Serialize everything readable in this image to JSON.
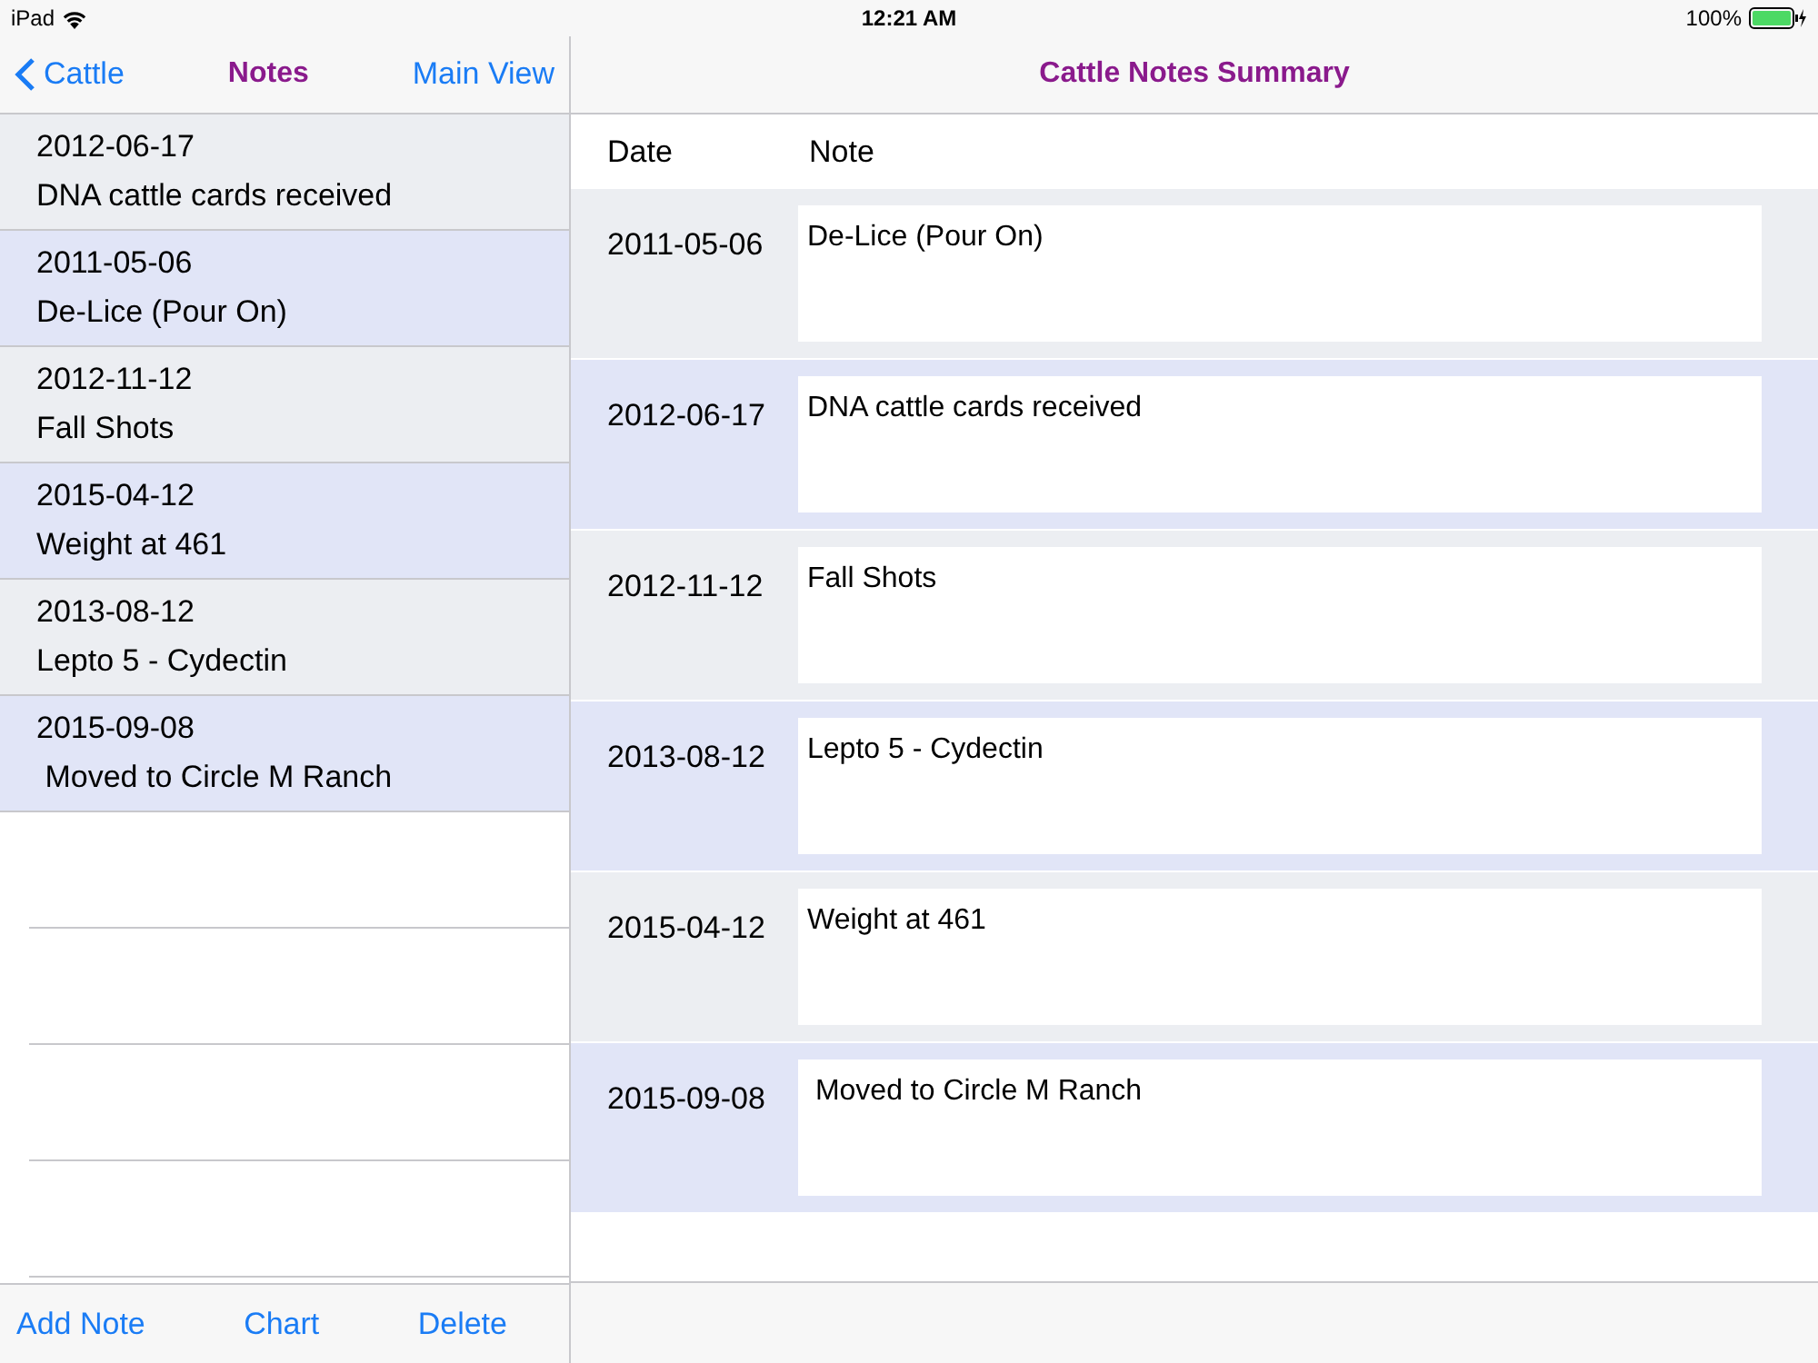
{
  "status_bar": {
    "device": "iPad",
    "time": "12:21 AM",
    "battery": "100%"
  },
  "left_nav": {
    "back": "Cattle",
    "title": "Notes",
    "action": "Main View"
  },
  "notes": [
    {
      "date": "2012-06-17",
      "note": "DNA cattle cards received"
    },
    {
      "date": "2011-05-06",
      "note": "De-Lice (Pour On)"
    },
    {
      "date": "2012-11-12",
      "note": "Fall Shots"
    },
    {
      "date": "2015-04-12",
      "note": "Weight at 461"
    },
    {
      "date": "2013-08-12",
      "note": "Lepto 5 - Cydectin"
    },
    {
      "date": "2015-09-08",
      "note": " Moved to Circle M Ranch"
    }
  ],
  "toolbar": [
    "Add Note",
    "Chart",
    "Delete"
  ],
  "summary": {
    "title": "Cattle Notes Summary",
    "columns": [
      "Date",
      "Note"
    ],
    "rows": [
      {
        "date": "2011-05-06",
        "note": "De-Lice (Pour On)"
      },
      {
        "date": "2012-06-17",
        "note": "DNA cattle cards received"
      },
      {
        "date": "2012-11-12",
        "note": "Fall Shots"
      },
      {
        "date": "2013-08-12",
        "note": "Lepto 5 - Cydectin"
      },
      {
        "date": "2015-04-12",
        "note": "Weight at 461"
      },
      {
        "date": "2015-09-08",
        "note": " Moved to Circle M Ranch"
      }
    ]
  }
}
